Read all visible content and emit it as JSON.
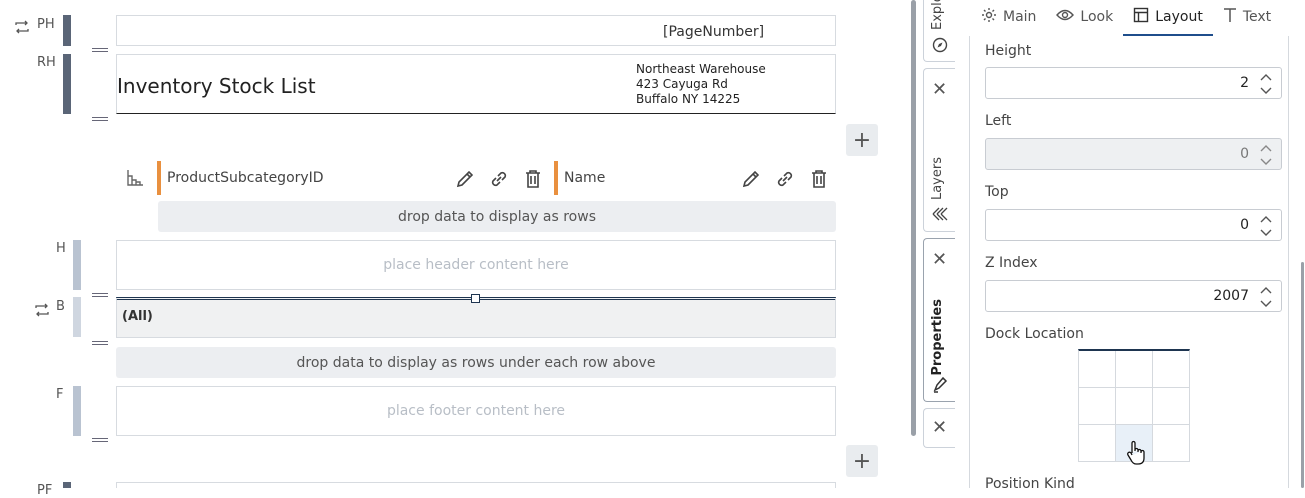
{
  "canvas": {
    "bands": {
      "page_header": "PH",
      "report_header": "RH",
      "header": "H",
      "body": "B",
      "footer": "F",
      "page_footer": "PF"
    },
    "page_number_text": "[PageNumber]",
    "report_title": "Inventory Stock List",
    "address_line1": "Northeast Warehouse",
    "address_line2": "423 Cayuga Rd",
    "address_line3": "Buffalo NY 14225",
    "group_fields": [
      {
        "label": "ProductSubcategoryID"
      },
      {
        "label": "Name"
      }
    ],
    "drop_rows_text": "drop data to display as rows",
    "header_placeholder": "place header content here",
    "body_value": "(All)",
    "drop_rows_under_text": "drop data to display as rows under each row above",
    "footer_placeholder": "place footer content here",
    "add_label": "+"
  },
  "side_tabs": {
    "explore": "Explore",
    "layers": "Layers",
    "properties": "Properties",
    "close_glyph": "✕"
  },
  "properties": {
    "tabs": [
      {
        "label": "Main"
      },
      {
        "label": "Look"
      },
      {
        "label": "Layout"
      },
      {
        "label": "Text"
      }
    ],
    "active_tab": "Layout",
    "height_label": "Height",
    "height_value": "2",
    "left_label": "Left",
    "left_value": "0",
    "top_label": "Top",
    "top_value": "0",
    "zindex_label": "Z Index",
    "zindex_value": "2007",
    "dock_label": "Dock Location",
    "position_kind_label": "Position Kind"
  },
  "colors": {
    "accent": "#1f4e8c",
    "group_field_marker": "#e9903f",
    "band_bar_dark": "#5a6577",
    "band_bar_light": "#b9c3d1"
  }
}
